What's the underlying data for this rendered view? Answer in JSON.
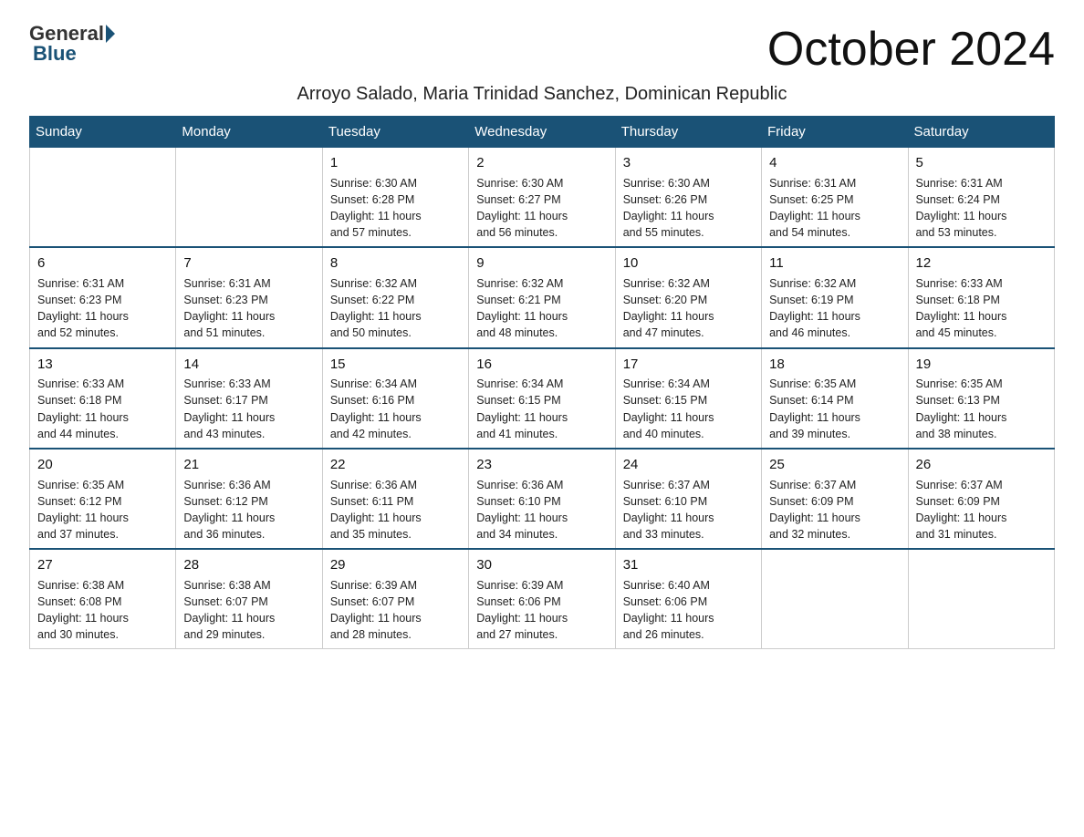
{
  "header": {
    "logo": {
      "general": "General",
      "blue": "Blue"
    },
    "title": "October 2024",
    "subtitle": "Arroyo Salado, Maria Trinidad Sanchez, Dominican Republic"
  },
  "calendar": {
    "days_of_week": [
      "Sunday",
      "Monday",
      "Tuesday",
      "Wednesday",
      "Thursday",
      "Friday",
      "Saturday"
    ],
    "weeks": [
      [
        {
          "day": "",
          "info": ""
        },
        {
          "day": "",
          "info": ""
        },
        {
          "day": "1",
          "info": "Sunrise: 6:30 AM\nSunset: 6:28 PM\nDaylight: 11 hours\nand 57 minutes."
        },
        {
          "day": "2",
          "info": "Sunrise: 6:30 AM\nSunset: 6:27 PM\nDaylight: 11 hours\nand 56 minutes."
        },
        {
          "day": "3",
          "info": "Sunrise: 6:30 AM\nSunset: 6:26 PM\nDaylight: 11 hours\nand 55 minutes."
        },
        {
          "day": "4",
          "info": "Sunrise: 6:31 AM\nSunset: 6:25 PM\nDaylight: 11 hours\nand 54 minutes."
        },
        {
          "day": "5",
          "info": "Sunrise: 6:31 AM\nSunset: 6:24 PM\nDaylight: 11 hours\nand 53 minutes."
        }
      ],
      [
        {
          "day": "6",
          "info": "Sunrise: 6:31 AM\nSunset: 6:23 PM\nDaylight: 11 hours\nand 52 minutes."
        },
        {
          "day": "7",
          "info": "Sunrise: 6:31 AM\nSunset: 6:23 PM\nDaylight: 11 hours\nand 51 minutes."
        },
        {
          "day": "8",
          "info": "Sunrise: 6:32 AM\nSunset: 6:22 PM\nDaylight: 11 hours\nand 50 minutes."
        },
        {
          "day": "9",
          "info": "Sunrise: 6:32 AM\nSunset: 6:21 PM\nDaylight: 11 hours\nand 48 minutes."
        },
        {
          "day": "10",
          "info": "Sunrise: 6:32 AM\nSunset: 6:20 PM\nDaylight: 11 hours\nand 47 minutes."
        },
        {
          "day": "11",
          "info": "Sunrise: 6:32 AM\nSunset: 6:19 PM\nDaylight: 11 hours\nand 46 minutes."
        },
        {
          "day": "12",
          "info": "Sunrise: 6:33 AM\nSunset: 6:18 PM\nDaylight: 11 hours\nand 45 minutes."
        }
      ],
      [
        {
          "day": "13",
          "info": "Sunrise: 6:33 AM\nSunset: 6:18 PM\nDaylight: 11 hours\nand 44 minutes."
        },
        {
          "day": "14",
          "info": "Sunrise: 6:33 AM\nSunset: 6:17 PM\nDaylight: 11 hours\nand 43 minutes."
        },
        {
          "day": "15",
          "info": "Sunrise: 6:34 AM\nSunset: 6:16 PM\nDaylight: 11 hours\nand 42 minutes."
        },
        {
          "day": "16",
          "info": "Sunrise: 6:34 AM\nSunset: 6:15 PM\nDaylight: 11 hours\nand 41 minutes."
        },
        {
          "day": "17",
          "info": "Sunrise: 6:34 AM\nSunset: 6:15 PM\nDaylight: 11 hours\nand 40 minutes."
        },
        {
          "day": "18",
          "info": "Sunrise: 6:35 AM\nSunset: 6:14 PM\nDaylight: 11 hours\nand 39 minutes."
        },
        {
          "day": "19",
          "info": "Sunrise: 6:35 AM\nSunset: 6:13 PM\nDaylight: 11 hours\nand 38 minutes."
        }
      ],
      [
        {
          "day": "20",
          "info": "Sunrise: 6:35 AM\nSunset: 6:12 PM\nDaylight: 11 hours\nand 37 minutes."
        },
        {
          "day": "21",
          "info": "Sunrise: 6:36 AM\nSunset: 6:12 PM\nDaylight: 11 hours\nand 36 minutes."
        },
        {
          "day": "22",
          "info": "Sunrise: 6:36 AM\nSunset: 6:11 PM\nDaylight: 11 hours\nand 35 minutes."
        },
        {
          "day": "23",
          "info": "Sunrise: 6:36 AM\nSunset: 6:10 PM\nDaylight: 11 hours\nand 34 minutes."
        },
        {
          "day": "24",
          "info": "Sunrise: 6:37 AM\nSunset: 6:10 PM\nDaylight: 11 hours\nand 33 minutes."
        },
        {
          "day": "25",
          "info": "Sunrise: 6:37 AM\nSunset: 6:09 PM\nDaylight: 11 hours\nand 32 minutes."
        },
        {
          "day": "26",
          "info": "Sunrise: 6:37 AM\nSunset: 6:09 PM\nDaylight: 11 hours\nand 31 minutes."
        }
      ],
      [
        {
          "day": "27",
          "info": "Sunrise: 6:38 AM\nSunset: 6:08 PM\nDaylight: 11 hours\nand 30 minutes."
        },
        {
          "day": "28",
          "info": "Sunrise: 6:38 AM\nSunset: 6:07 PM\nDaylight: 11 hours\nand 29 minutes."
        },
        {
          "day": "29",
          "info": "Sunrise: 6:39 AM\nSunset: 6:07 PM\nDaylight: 11 hours\nand 28 minutes."
        },
        {
          "day": "30",
          "info": "Sunrise: 6:39 AM\nSunset: 6:06 PM\nDaylight: 11 hours\nand 27 minutes."
        },
        {
          "day": "31",
          "info": "Sunrise: 6:40 AM\nSunset: 6:06 PM\nDaylight: 11 hours\nand 26 minutes."
        },
        {
          "day": "",
          "info": ""
        },
        {
          "day": "",
          "info": ""
        }
      ]
    ]
  }
}
